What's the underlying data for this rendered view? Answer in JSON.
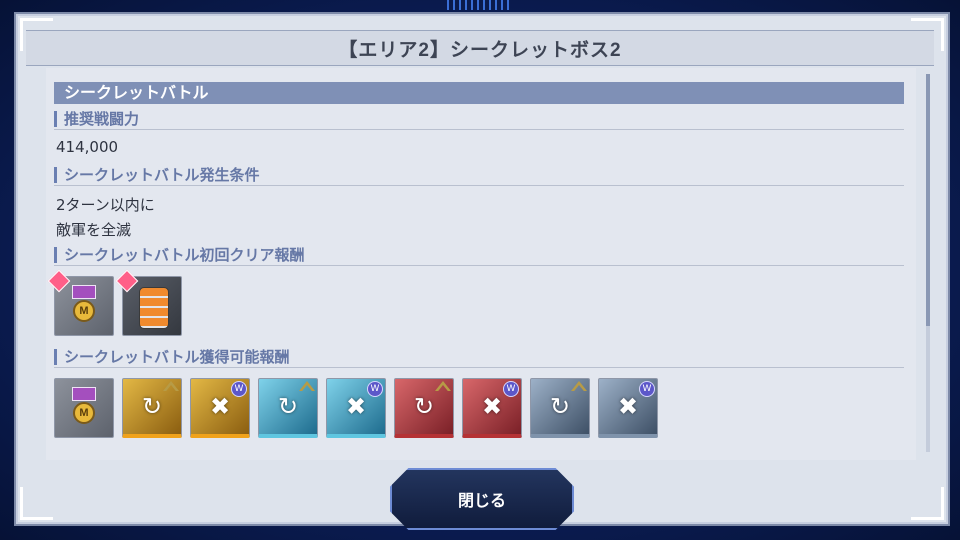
{
  "dialog": {
    "title": "【エリア2】シークレットボス2",
    "section_header": "シークレットバトル",
    "recommended_power": {
      "label": "推奨戦闘力",
      "value": "414,000"
    },
    "conditions": {
      "label": "シークレットバトル発生条件",
      "lines": [
        "2ターン以内に",
        "敵軍を全滅"
      ]
    },
    "first_clear_rewards": {
      "label": "シークレットバトル初回クリア報酬",
      "items": [
        {
          "icon": "medal-icon",
          "badge": "new"
        },
        {
          "icon": "barrel-icon",
          "badge": "new"
        }
      ]
    },
    "obtainable_rewards": {
      "label": "シークレットバトル獲得可能報酬",
      "items": [
        {
          "icon": "medal-icon",
          "color": "gray",
          "badge": "none"
        },
        {
          "icon": "gold-chip-icon",
          "color": "gold",
          "badge": "chevron"
        },
        {
          "icon": "gold-chip-icon",
          "color": "gold",
          "badge": "tier"
        },
        {
          "icon": "cyan-chip-icon",
          "color": "cyan",
          "badge": "chevron"
        },
        {
          "icon": "cyan-chip-icon",
          "color": "cyan",
          "badge": "tier"
        },
        {
          "icon": "red-chip-icon",
          "color": "red",
          "badge": "chevron"
        },
        {
          "icon": "red-chip-icon",
          "color": "red",
          "badge": "tier"
        },
        {
          "icon": "steel-chip-icon",
          "color": "steel",
          "badge": "chevron"
        },
        {
          "icon": "steel-chip-icon",
          "color": "steel",
          "badge": "tier"
        }
      ]
    },
    "close_label": "閉じる"
  },
  "colors": {
    "section_header_bg": "#7f90b6",
    "subhead_text": "#6678a6",
    "frame_bg": "#0b1d55"
  }
}
